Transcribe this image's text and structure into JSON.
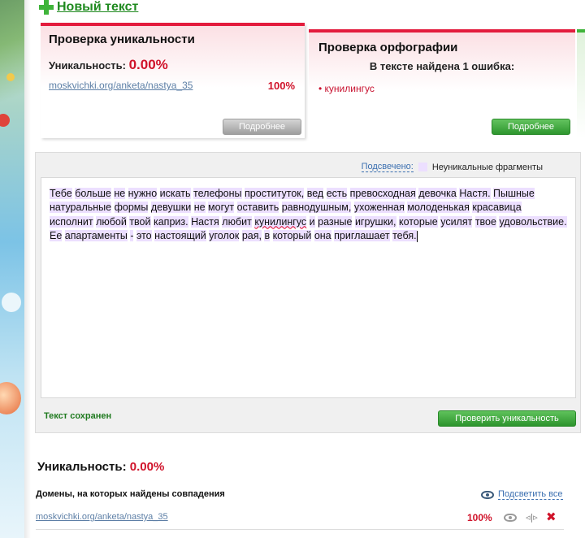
{
  "header": {
    "new_text_label": "Новый текст"
  },
  "uniqueness_panel": {
    "title": "Проверка уникальности",
    "label": "Уникальность:",
    "percent": "0.00%",
    "source_link": "moskvichki.org/anketa/nastya_35",
    "source_percent": "100%",
    "details_button": "Подробнее"
  },
  "spelling_panel": {
    "title": "Проверка орфографии",
    "found_text": "В тексте найдена 1 ошибка:",
    "error_word": "• кунилингус",
    "details_button": "Подробнее"
  },
  "editor": {
    "highlight_label": "Подсвечено:",
    "highlight_desc": "Неуникальные фрагменты",
    "words": [
      "Тебе",
      "больше",
      "не",
      "нужно",
      "искать",
      "телефоны",
      "проституток,",
      "вед",
      "есть",
      "превосходная",
      "девочка",
      "Настя.",
      "Пышные",
      "натуральные",
      "формы",
      "девушки",
      "не",
      "могут",
      "оставить",
      "равнодушным,",
      "ухоженная",
      "молоденькая",
      "красавица",
      "исполнит",
      "любой",
      "твой",
      "каприз.",
      "Настя",
      "любит",
      "кунилингус",
      "и",
      "разные",
      "игрушки,",
      "которые",
      "усилят",
      "твое",
      "удовольствие.",
      "Ее",
      "апартаменты",
      "-",
      "это",
      "настоящий",
      "уголок",
      "рая,",
      "в",
      "который",
      "она",
      "приглашает",
      "тебя."
    ],
    "error_word": "кунилингус",
    "saved_status": "Текст сохранен",
    "check_button": "Проверить уникальность"
  },
  "results": {
    "title_label": "Уникальность:",
    "title_percent": "0.00%",
    "domains_heading": "Домены, на которых найдены совпадения",
    "highlight_all": "Подсветить все",
    "rows": [
      {
        "link": "moskvichki.org/anketa/nastya_35",
        "percent": "100%"
      }
    ]
  },
  "colors": {
    "accent_red": "#d0132a",
    "accent_green": "#2e962e",
    "highlight": "#ecdfff",
    "link": "#5d7fa6"
  }
}
